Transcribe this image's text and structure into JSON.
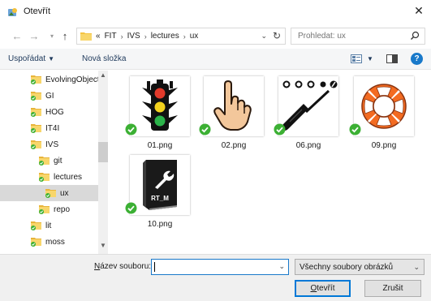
{
  "window": {
    "title": "Otevřít",
    "close_icon": "close-icon"
  },
  "address": {
    "prefix": "«",
    "crumbs": [
      "FIT",
      "IVS",
      "lectures",
      "ux"
    ]
  },
  "search": {
    "placeholder": "Prohledat: ux"
  },
  "toolbar": {
    "organize_label": "Uspořádat",
    "new_folder_label": "Nová složka"
  },
  "navpane": {
    "items": [
      {
        "label": "EvolvingObject",
        "indent": 0,
        "selected": false
      },
      {
        "label": "GI",
        "indent": 0,
        "selected": false
      },
      {
        "label": "HOG",
        "indent": 0,
        "selected": false
      },
      {
        "label": "IT4I",
        "indent": 0,
        "selected": false
      },
      {
        "label": "IVS",
        "indent": 0,
        "selected": false
      },
      {
        "label": "git",
        "indent": 1,
        "selected": false
      },
      {
        "label": "lectures",
        "indent": 1,
        "selected": false
      },
      {
        "label": "ux",
        "indent": 2,
        "selected": true
      },
      {
        "label": "repo",
        "indent": 1,
        "selected": false
      },
      {
        "label": "lit",
        "indent": 0,
        "selected": false
      },
      {
        "label": "moss",
        "indent": 0,
        "selected": false
      }
    ]
  },
  "files": [
    {
      "name": "01.png",
      "icon": "traffic-light-icon"
    },
    {
      "name": "02.png",
      "icon": "pointing-hand-icon"
    },
    {
      "name": "06.png",
      "icon": "screwdriver-icon"
    },
    {
      "name": "09.png",
      "icon": "lifebuoy-icon"
    },
    {
      "name": "10.png",
      "icon": "rtm-manual-icon"
    }
  ],
  "bottom": {
    "filename_label_underline": "N",
    "filename_label_rest": "ázev souboru:",
    "filename_value": "",
    "filetype_value": "Všechny soubory obrázků",
    "open_label_underline": "O",
    "open_label_rest": "tevřít",
    "cancel_label": "Zrušit"
  },
  "colors": {
    "accent": "#1979ca",
    "sync_check": "#3cb034",
    "folder": "#f5c342"
  }
}
